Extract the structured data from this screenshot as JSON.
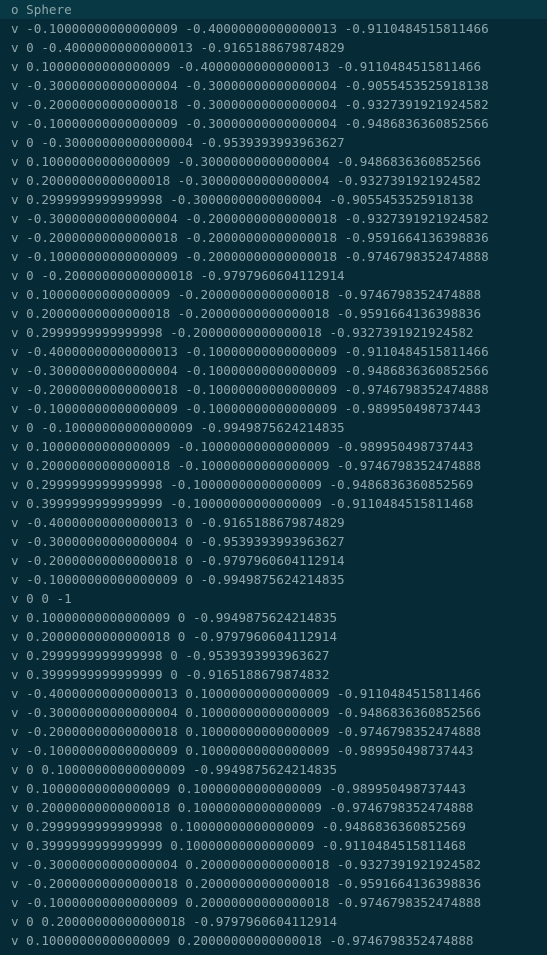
{
  "editor": {
    "lines": [
      "o Sphere",
      "v -0.10000000000000009 -0.40000000000000013 -0.9110484515811466",
      "v 0 -0.40000000000000013 -0.9165188679874829",
      "v 0.10000000000000009 -0.40000000000000013 -0.9110484515811466",
      "v -0.30000000000000004 -0.30000000000000004 -0.9055453525918138",
      "v -0.20000000000000018 -0.30000000000000004 -0.9327391921924582",
      "v -0.10000000000000009 -0.30000000000000004 -0.9486836360852566",
      "v 0 -0.30000000000000004 -0.9539393993963627",
      "v 0.10000000000000009 -0.30000000000000004 -0.9486836360852566",
      "v 0.20000000000000018 -0.30000000000000004 -0.9327391921924582",
      "v 0.2999999999999998 -0.30000000000000004 -0.9055453525918138",
      "v -0.30000000000000004 -0.20000000000000018 -0.9327391921924582",
      "v -0.20000000000000018 -0.20000000000000018 -0.9591664136398836",
      "v -0.10000000000000009 -0.20000000000000018 -0.9746798352474888",
      "v 0 -0.20000000000000018 -0.9797960604112914",
      "v 0.10000000000000009 -0.20000000000000018 -0.9746798352474888",
      "v 0.20000000000000018 -0.20000000000000018 -0.9591664136398836",
      "v 0.2999999999999998 -0.20000000000000018 -0.9327391921924582",
      "v -0.40000000000000013 -0.10000000000000009 -0.9110484515811466",
      "v -0.30000000000000004 -0.10000000000000009 -0.9486836360852566",
      "v -0.20000000000000018 -0.10000000000000009 -0.9746798352474888",
      "v -0.10000000000000009 -0.10000000000000009 -0.989950498737443",
      "v 0 -0.10000000000000009 -0.9949875624214835",
      "v 0.10000000000000009 -0.10000000000000009 -0.989950498737443",
      "v 0.20000000000000018 -0.10000000000000009 -0.9746798352474888",
      "v 0.2999999999999998 -0.10000000000000009 -0.9486836360852569",
      "v 0.3999999999999999 -0.10000000000000009 -0.9110484515811468",
      "v -0.40000000000000013 0 -0.9165188679874829",
      "v -0.30000000000000004 0 -0.9539393993963627",
      "v -0.20000000000000018 0 -0.9797960604112914",
      "v -0.10000000000000009 0 -0.9949875624214835",
      "v 0 0 -1",
      "v 0.10000000000000009 0 -0.9949875624214835",
      "v 0.20000000000000018 0 -0.9797960604112914",
      "v 0.2999999999999998 0 -0.9539393993963627",
      "v 0.3999999999999999 0 -0.9165188679874832",
      "v -0.40000000000000013 0.10000000000000009 -0.9110484515811466",
      "v -0.30000000000000004 0.10000000000000009 -0.9486836360852566",
      "v -0.20000000000000018 0.10000000000000009 -0.9746798352474888",
      "v -0.10000000000000009 0.10000000000000009 -0.989950498737443",
      "v 0 0.10000000000000009 -0.9949875624214835",
      "v 0.10000000000000009 0.10000000000000009 -0.989950498737443",
      "v 0.20000000000000018 0.10000000000000009 -0.9746798352474888",
      "v 0.2999999999999998 0.10000000000000009 -0.9486836360852569",
      "v 0.3999999999999999 0.10000000000000009 -0.9110484515811468",
      "v -0.30000000000000004 0.20000000000000018 -0.9327391921924582",
      "v -0.20000000000000018 0.20000000000000018 -0.9591664136398836",
      "v -0.10000000000000009 0.20000000000000018 -0.9746798352474888",
      "v 0 0.20000000000000018 -0.9797960604112914",
      "v 0.10000000000000009 0.20000000000000018 -0.9746798352474888"
    ]
  }
}
